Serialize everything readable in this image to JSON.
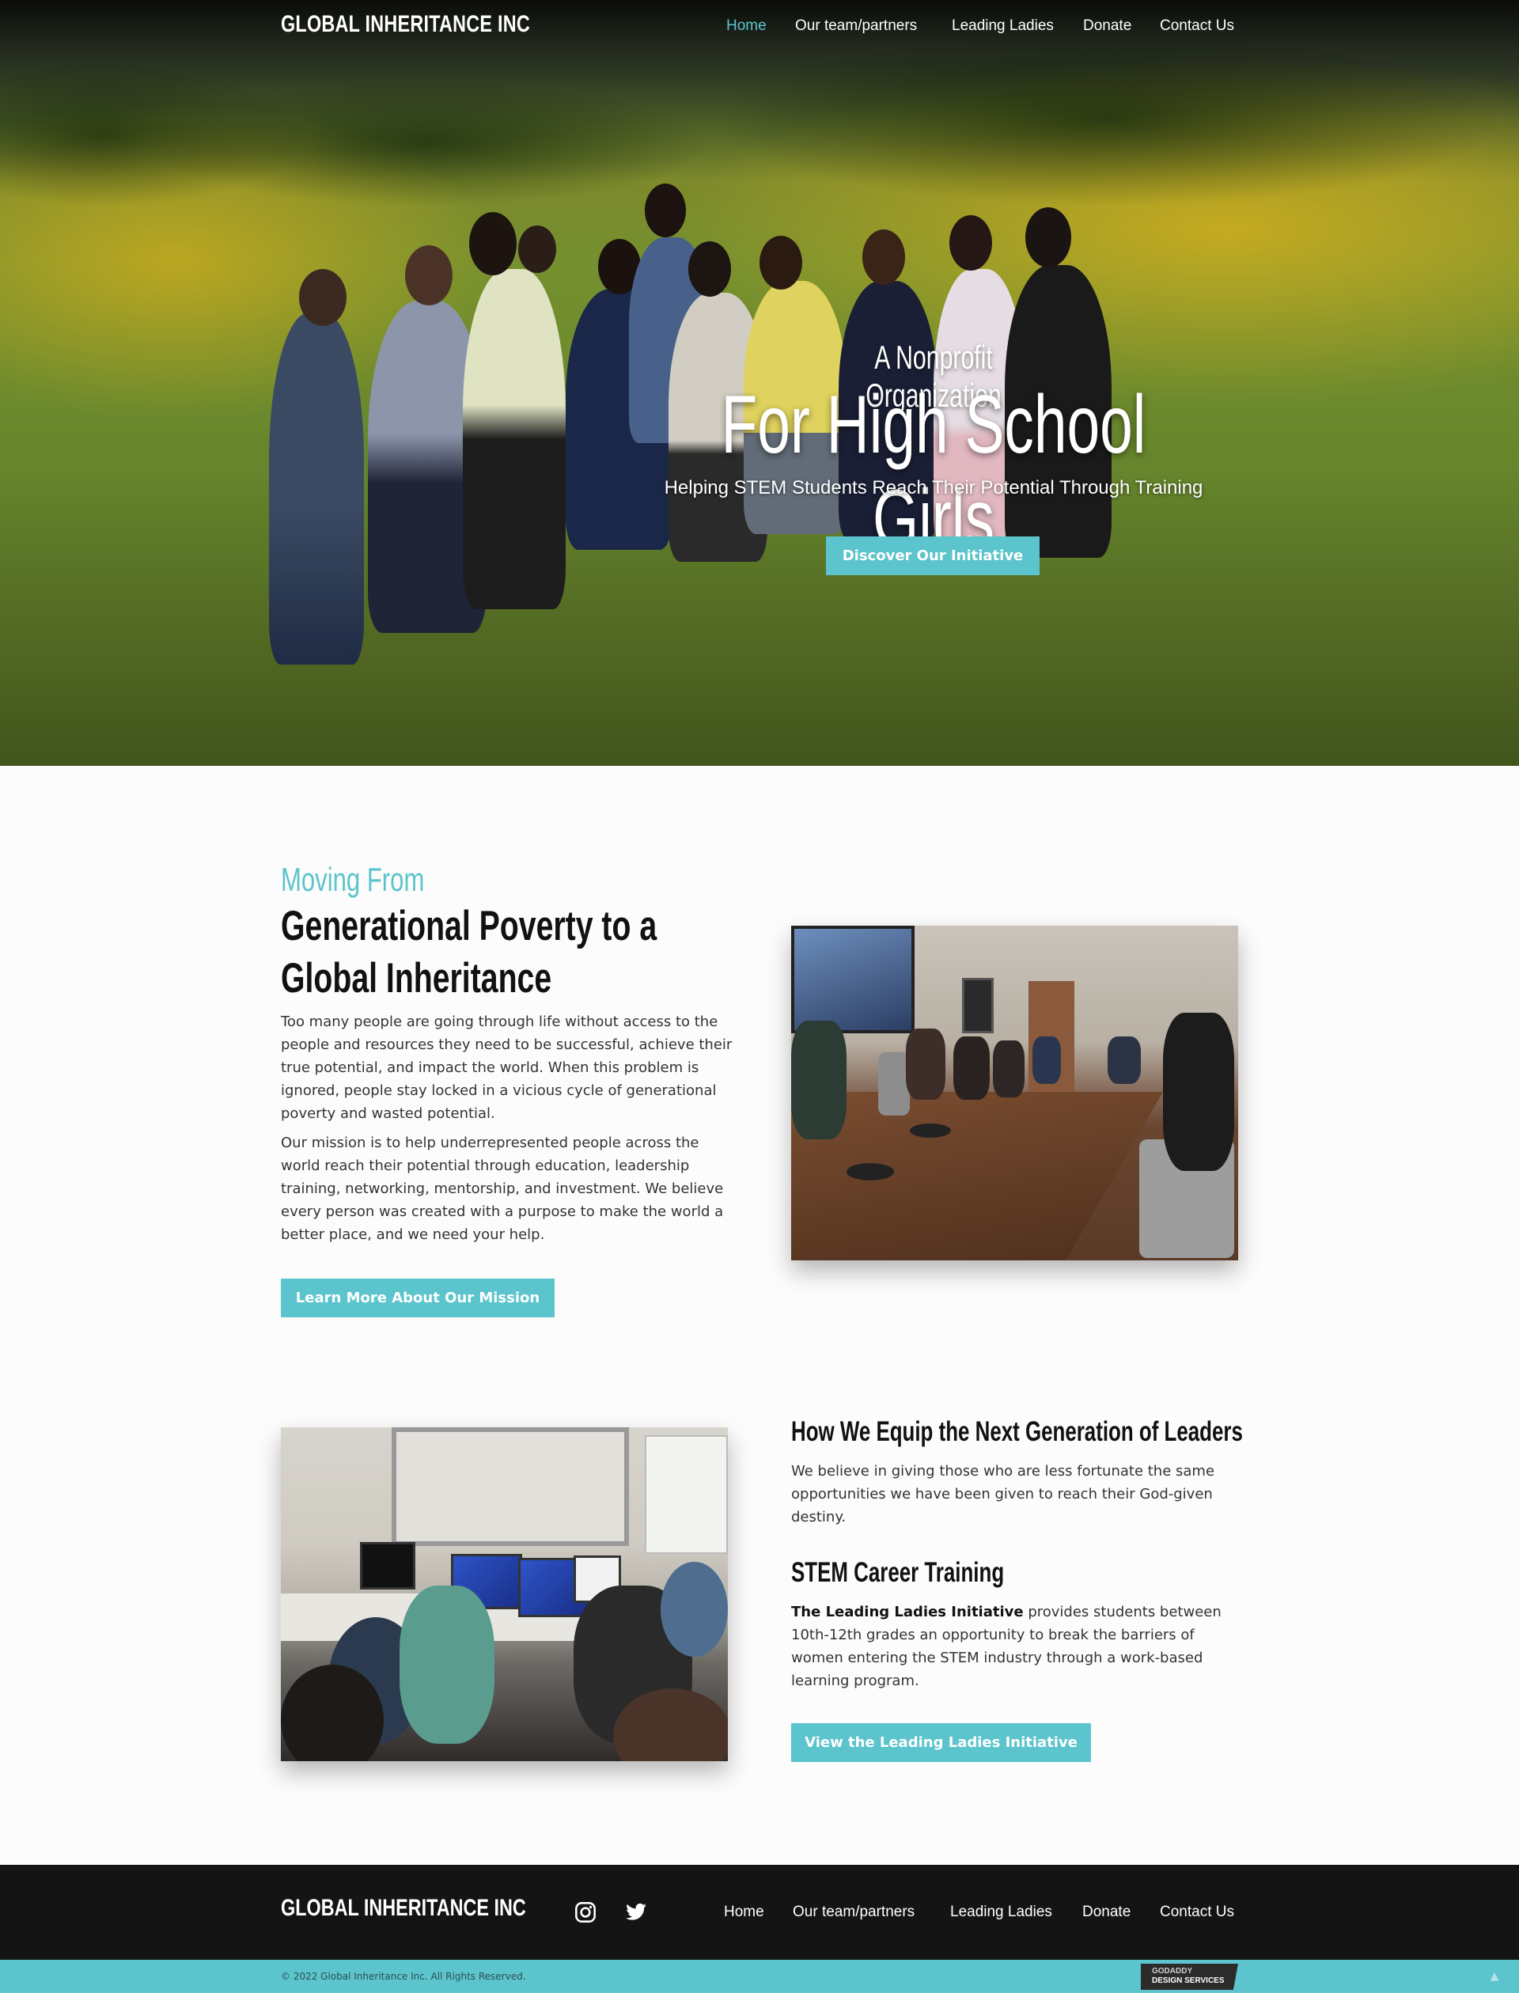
{
  "brand": "GLOBAL INHERITANCE INC",
  "nav": [
    {
      "label": "Home",
      "active": true
    },
    {
      "label": "Our team/partners",
      "active": false
    },
    {
      "label": "Leading Ladies",
      "active": false
    },
    {
      "label": "Donate",
      "active": false
    },
    {
      "label": "Contact Us",
      "active": false
    }
  ],
  "hero": {
    "subtitle": "A Nonprofit Organization",
    "title": "For High School Girls",
    "tagline": "Helping STEM Students Reach Their Potential Through Training",
    "button": "Discover Our Initiative"
  },
  "mission": {
    "eyebrow": "Moving From",
    "heading": "Generational Poverty to a Global Inheritance",
    "p1": "Too many people are going through life without access to the people and resources they need to be successful, achieve their true potential, and impact the world. When this problem is ignored, people stay locked in a vicious cycle of generational poverty and wasted potential.",
    "p2": "Our mission is to help underrepresented people across the world reach their potential through education, leadership training, networking, mentorship, and investment. We believe every person was created with a purpose to make the world a better place, and we need your help.",
    "button": "Learn More About Our Mission"
  },
  "equip": {
    "heading": "How We Equip the Next Generation of Leaders",
    "p": "We believe in giving those who are less fortunate the same opportunities we have been given to reach their God-given destiny.",
    "stem_heading": "STEM Career Training",
    "stem_bold": "The Leading Ladies Initiative",
    "stem_rest": " provides students between 10th-12th grades an opportunity to break the barriers of women entering the STEM industry through a work-based learning program.",
    "button": "View the Leading Ladies Initiative"
  },
  "footer": {
    "brand": "GLOBAL INHERITANCE INC",
    "social": [
      "instagram-icon",
      "twitter-icon"
    ],
    "links": [
      "Home",
      "Our team/partners",
      "Leading Ladies",
      "Donate",
      "Contact Us"
    ],
    "copyright": "© 2022 Global Inheritance Inc. All Rights Reserved.",
    "badge_top": "GODADDY",
    "badge_bottom": "DESIGN SERVICES"
  },
  "colors": {
    "accent": "#5bc4cc",
    "footer_bg": "#141414",
    "text": "#333333"
  }
}
